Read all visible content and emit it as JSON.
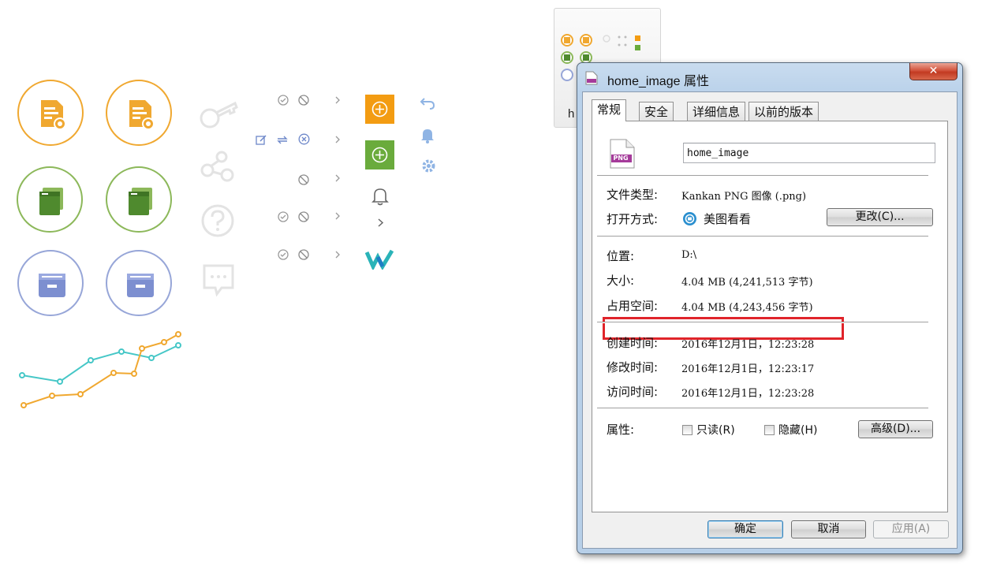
{
  "thumbnail": {
    "label": "h"
  },
  "dialog": {
    "title": "home_image 属性",
    "close_label": "✕",
    "tabs": [
      "常规",
      "安全",
      "详细信息",
      "以前的版本"
    ],
    "file_icon_text": "PNG",
    "filename": "home_image",
    "rows": {
      "type_label": "文件类型:",
      "type_value": "Kankan PNG 图像 (.png)",
      "open_label": "打开方式:",
      "open_value": "美图看看",
      "change_button": "更改(C)...",
      "location_label": "位置:",
      "location_value": "D:\\",
      "size_label": "大小:",
      "size_value": "4.04 MB (4,241,513 字节)",
      "disk_label": "占用空间:",
      "disk_value": "4.04 MB (4,243,456 字节)",
      "created_label": "创建时间:",
      "created_value": "2016年12月1日，12:23:28",
      "modified_label": "修改时间:",
      "modified_value": "2016年12月1日，12:23:17",
      "accessed_label": "访问时间:",
      "accessed_value": "2016年12月1日，12:23:28",
      "attr_label": "属性:",
      "readonly_label": "只读(R)",
      "hidden_label": "隐藏(H)",
      "advanced_button": "高级(D)..."
    },
    "buttons": {
      "ok": "确定",
      "cancel": "取消",
      "apply": "应用(A)"
    }
  },
  "colors": {
    "orange": "#f0a830",
    "green": "#8cb85a",
    "blue": "#97a6d8",
    "highlight": "#e0242a",
    "teal": "#46c7c7"
  }
}
